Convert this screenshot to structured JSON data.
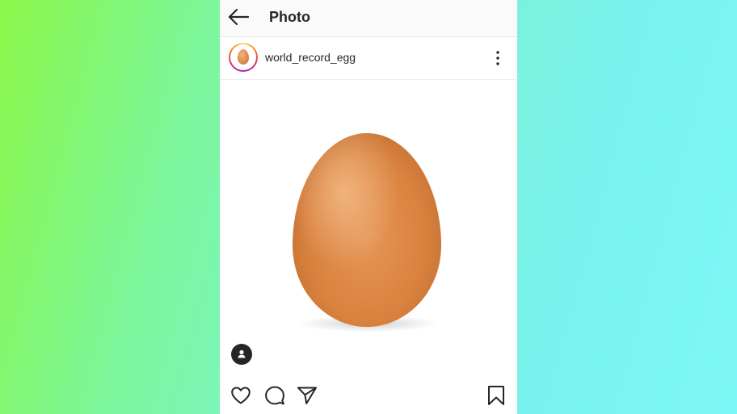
{
  "header": {
    "title": "Photo",
    "back_icon": "arrow-left-icon"
  },
  "post": {
    "username": "world_record_egg",
    "avatar_icon": "egg-avatar",
    "menu_icon": "more-vertical-icon"
  },
  "actions": {
    "like_icon": "heart-icon",
    "comment_icon": "comment-icon",
    "share_icon": "send-icon",
    "save_icon": "bookmark-icon",
    "tag_icon": "user-tag-icon"
  },
  "colors": {
    "text": "#262626",
    "background_left": "#8cf84a",
    "background_right": "#7ef8f6",
    "egg": "#d9823f"
  }
}
